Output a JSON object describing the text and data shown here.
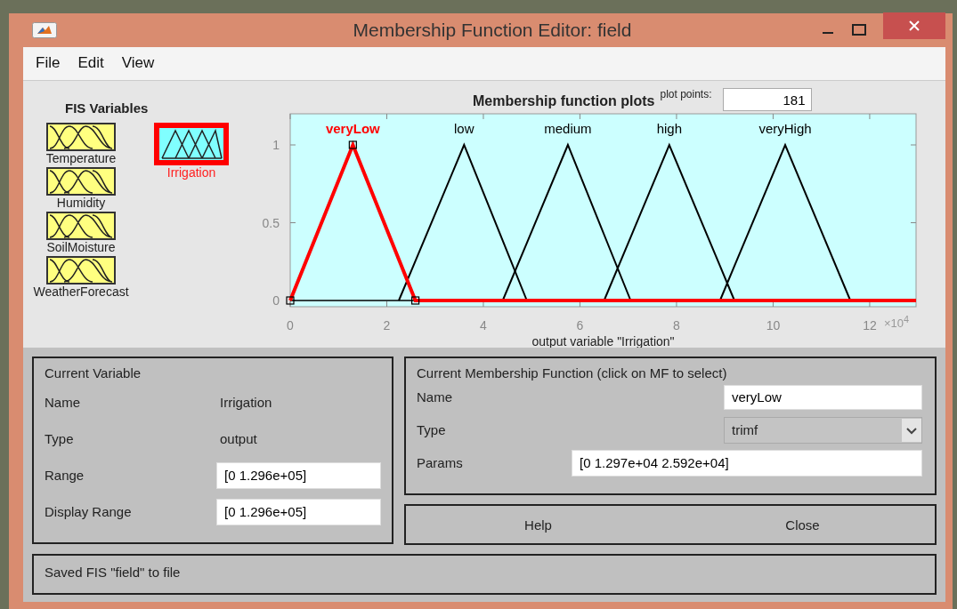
{
  "window": {
    "title": "Membership Function Editor: field"
  },
  "menu": [
    "File",
    "Edit",
    "View"
  ],
  "fis_variables": {
    "title": "FIS Variables",
    "inputs": [
      {
        "name": "Temperature",
        "selected": false
      },
      {
        "name": "Humidity",
        "selected": false
      },
      {
        "name": "SoilMoisture",
        "selected": false
      },
      {
        "name": "WeatherForecast",
        "selected": false
      }
    ],
    "outputs": [
      {
        "name": "Irrigation",
        "selected": true
      }
    ]
  },
  "plot": {
    "curves": [
      {
        "selected": true
      },
      {
        "selected": false
      },
      {
        "selected": false
      },
      {
        "selected": false
      },
      {
        "selected": false
      }
    ],
    "plot_points_label": "plot points:",
    "plot_points": "181",
    "x_multiplier": "×10$^{4}$",
    "chart_data": {
      "type": "line",
      "title": "Membership function plots",
      "xlabel": "output variable \"Irrigation\"",
      "x": [
        0,
        1.297,
        2.25,
        2.592,
        3.6,
        4.4,
        4.9,
        5.75,
        6.5,
        7.05,
        7.85,
        8.9,
        9.2,
        10.25,
        11.6,
        12.96
      ],
      "series": [
        {
          "name": "veryLow",
          "color": "#ff0000",
          "values": [
            0,
            1,
            0.264,
            0,
            0,
            0,
            0,
            0,
            0,
            0,
            0,
            0,
            0,
            0,
            0,
            0
          ]
        },
        {
          "name": "low",
          "color": "#000000",
          "values": [
            null,
            null,
            0,
            0.253,
            1,
            0.385,
            0,
            null,
            null,
            null,
            null,
            null,
            null,
            null,
            null,
            null
          ]
        },
        {
          "name": "medium",
          "color": "#000000",
          "values": [
            null,
            null,
            null,
            null,
            null,
            0,
            0.37,
            1,
            0.423,
            0,
            null,
            null,
            null,
            null,
            null,
            null
          ]
        },
        {
          "name": "high",
          "color": "#000000",
          "values": [
            null,
            null,
            null,
            null,
            null,
            null,
            null,
            null,
            0,
            0.407,
            1,
            0.222,
            0,
            null,
            null,
            null
          ]
        },
        {
          "name": "veryHigh",
          "color": "#000000",
          "values": [
            null,
            null,
            null,
            null,
            null,
            null,
            null,
            null,
            null,
            null,
            null,
            0,
            0.222,
            1,
            0,
            null
          ]
        }
      ],
      "xlim": [
        0,
        12.96
      ],
      "ylim": [
        -0.04,
        1.2
      ],
      "xticks": [
        0,
        2,
        4,
        6,
        8,
        10,
        12
      ],
      "yticks": [
        0,
        0.5,
        1
      ]
    }
  },
  "current_variable": {
    "title": "Current Variable",
    "fields": [
      {
        "label": "Name",
        "value": "Irrigation",
        "kind": "text"
      },
      {
        "label": "Type",
        "value": "output",
        "kind": "text"
      },
      {
        "label": "Range",
        "value": "[0 1.296e+05]",
        "kind": "input"
      },
      {
        "label": "Display Range",
        "value": "[0 1.296e+05]",
        "kind": "input"
      }
    ]
  },
  "current_mf": {
    "title": "Current Membership Function (click on MF to select)",
    "fields": [
      {
        "label": "Name",
        "value": "veryLow",
        "kind": "input"
      },
      {
        "label": "Type",
        "value": "trimf",
        "kind": "dropdown"
      },
      {
        "label": "Params",
        "value": "[0 1.297e+04 2.592e+04]",
        "kind": "wide-input"
      }
    ]
  },
  "buttons": [
    "Help",
    "Close"
  ],
  "status": "Saved FIS \"field\" to file"
}
